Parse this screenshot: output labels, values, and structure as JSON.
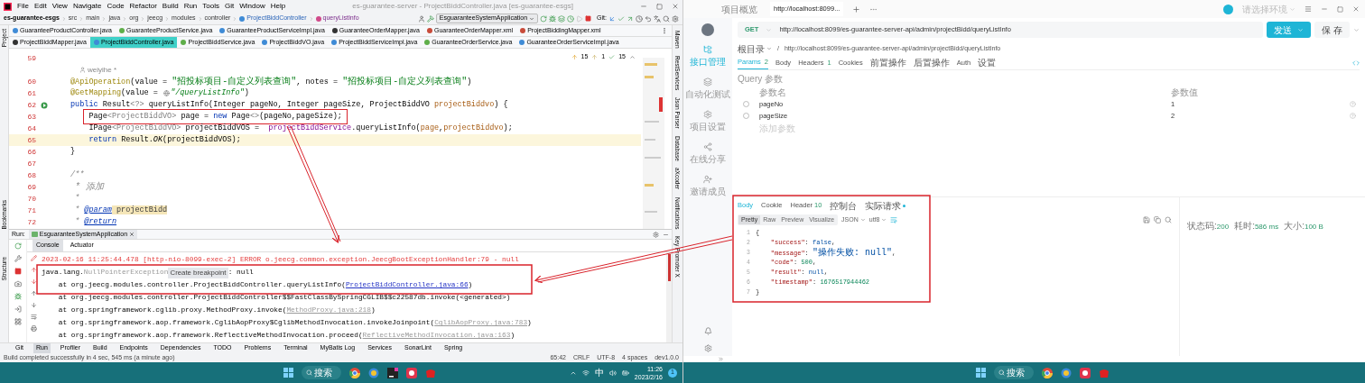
{
  "ide": {
    "menu": [
      "File",
      "Edit",
      "View",
      "Navigate",
      "Code",
      "Refactor",
      "Build",
      "Run",
      "Tools",
      "Git",
      "Window",
      "Help"
    ],
    "title": "es-guarantee-server - ProjectBiddController.java [es-guarantee-esgs]",
    "project": "es-guarantee-esgs",
    "breadcrumbs": [
      {
        "label": "src",
        "kind": "folder"
      },
      {
        "label": "main",
        "kind": "folder"
      },
      {
        "label": "java",
        "kind": "folder"
      },
      {
        "label": "org",
        "kind": "folder"
      },
      {
        "label": "jeecg",
        "kind": "folder"
      },
      {
        "label": "modules",
        "kind": "folder"
      },
      {
        "label": "controller",
        "kind": "folder"
      },
      {
        "label": "ProjectBiddController",
        "kind": "class"
      },
      {
        "label": "queryListInfo",
        "kind": "method"
      }
    ],
    "run_config": "EsguaranteeSystemApplication",
    "git_label": "Git:",
    "tab_rows": [
      [
        {
          "label": "GuaranteeProductController.java",
          "kind": "class",
          "selected": false
        },
        {
          "label": "GuaranteeProductService.java",
          "kind": "interface",
          "selected": false
        },
        {
          "label": "GuaranteeProductServiceImpl.java",
          "kind": "class",
          "selected": false
        },
        {
          "label": "GuaranteeOrderMapper.java",
          "kind": "mapper",
          "selected": false
        },
        {
          "label": "GuaranteeOrderMapper.xml",
          "kind": "xml",
          "selected": false
        },
        {
          "label": "ProjectBiddingMapper.xml",
          "kind": "xml",
          "selected": false
        }
      ],
      [
        {
          "label": "ProjectBiddMapper.java",
          "kind": "mapper",
          "selected": false
        },
        {
          "label": "ProjectBiddController.java",
          "kind": "class",
          "selected": true
        },
        {
          "label": "ProjectBiddService.java",
          "kind": "interface",
          "selected": false
        },
        {
          "label": "ProjectBiddVO.java",
          "kind": "class",
          "selected": false
        },
        {
          "label": "ProjectBiddServiceImpl.java",
          "kind": "class",
          "selected": false
        },
        {
          "label": "GuaranteeOrderService.java",
          "kind": "interface",
          "selected": false
        },
        {
          "label": "GuaranteeOrderServiceImpl.java",
          "kind": "class",
          "selected": false
        }
      ]
    ],
    "inspections": {
      "warnings": "15",
      "weak_warnings": "1",
      "ok": "15"
    },
    "code": [
      {
        "kind": "line",
        "number": "59",
        "current": false,
        "runnable": false,
        "boxed": false
      },
      {
        "kind": "author",
        "text": "weiyihe *"
      },
      {
        "kind": "line",
        "number": "60",
        "current": false,
        "runnable": false,
        "boxed": false,
        "segments": [
          {
            "text": "@ApiOperation",
            "kind": "ann"
          },
          {
            "text": "(value = ",
            "kind": "plain"
          },
          {
            "text": "\"招投标项目-自定义列表查询\"",
            "kind": "str"
          },
          {
            "text": ", notes = ",
            "kind": "plain"
          },
          {
            "text": "\"招投标项目-自定义列表查询\"",
            "kind": "str"
          },
          {
            "text": ")",
            "kind": "plain"
          }
        ]
      },
      {
        "kind": "line",
        "number": "61",
        "current": false,
        "runnable": false,
        "boxed": false,
        "segments": [
          {
            "text": "@GetMapping",
            "kind": "ann"
          },
          {
            "text": "(value = ",
            "kind": "plain"
          },
          {
            "text": "\"/queryListInfo\"",
            "kind": "route"
          },
          {
            "text": ")",
            "kind": "plain"
          }
        ]
      },
      {
        "kind": "line",
        "number": "62",
        "current": false,
        "runnable": true,
        "boxed": false,
        "segments": [
          {
            "text": "public ",
            "kind": "kw"
          },
          {
            "text": "Result",
            "kind": "plain"
          },
          {
            "text": "<?>",
            "kind": "gen"
          },
          {
            "text": " queryListInfo(Integer pageNo, Integer pageSize, ProjectBiddVO ",
            "kind": "plain"
          },
          {
            "text": "projectBiddvo",
            "kind": "param"
          },
          {
            "text": ") {",
            "kind": "plain"
          }
        ]
      },
      {
        "kind": "line",
        "number": "63",
        "current": false,
        "runnable": false,
        "boxed": true,
        "segments": [
          {
            "text": "    Page",
            "kind": "plain"
          },
          {
            "text": "<ProjectBiddVO>",
            "kind": "gen"
          },
          {
            "text": " page = ",
            "kind": "plain"
          },
          {
            "text": "new ",
            "kind": "kw"
          },
          {
            "text": "Page",
            "kind": "plain"
          },
          {
            "text": "<>",
            "kind": "gen"
          },
          {
            "text": "(pageNo,pageSize);",
            "kind": "plain"
          }
        ]
      },
      {
        "kind": "line",
        "number": "64",
        "current": false,
        "runnable": false,
        "boxed": false,
        "segments": [
          {
            "text": "    IPage",
            "kind": "plain"
          },
          {
            "text": "<ProjectBiddVO>",
            "kind": "gen"
          },
          {
            "text": " projectBiddVOS =  ",
            "kind": "plain"
          },
          {
            "text": "projectBiddService",
            "kind": "field"
          },
          {
            "text": ".queryListInfo(",
            "kind": "plain"
          },
          {
            "text": "page",
            "kind": "param"
          },
          {
            "text": ",",
            "kind": "plain"
          },
          {
            "text": "projectBiddvo",
            "kind": "param"
          },
          {
            "text": ");",
            "kind": "plain"
          }
        ]
      },
      {
        "kind": "line",
        "number": "65",
        "current": true,
        "runnable": false,
        "boxed": false,
        "segments": [
          {
            "text": "    return ",
            "kind": "kw"
          },
          {
            "text": "Result.",
            "kind": "plain"
          },
          {
            "text": "OK",
            "kind": "static"
          },
          {
            "text": "(projectBiddVOS);",
            "kind": "plain"
          }
        ]
      },
      {
        "kind": "line",
        "number": "66",
        "current": false,
        "runnable": false,
        "boxed": false,
        "segments": [
          {
            "text": "}",
            "kind": "plain"
          }
        ]
      },
      {
        "kind": "line",
        "number": "67",
        "current": false,
        "runnable": false,
        "boxed": false
      },
      {
        "kind": "line",
        "number": "68",
        "current": false,
        "runnable": false,
        "boxed": false,
        "segments": [
          {
            "text": "/**",
            "kind": "comment"
          }
        ]
      },
      {
        "kind": "line",
        "number": "69",
        "current": false,
        "runnable": false,
        "boxed": false,
        "segments": [
          {
            "text": " * 添加",
            "kind": "comment"
          }
        ]
      },
      {
        "kind": "line",
        "number": "70",
        "current": false,
        "runnable": false,
        "boxed": false,
        "segments": [
          {
            "text": " *",
            "kind": "comment"
          }
        ]
      },
      {
        "kind": "line",
        "number": "71",
        "current": false,
        "runnable": false,
        "boxed": false,
        "segments": [
          {
            "text": " * ",
            "kind": "comment"
          },
          {
            "text": "@param",
            "kind": "doctag"
          },
          {
            "text": " projectBidd",
            "kind": "docparam"
          }
        ]
      },
      {
        "kind": "line",
        "number": "72",
        "current": false,
        "runnable": false,
        "boxed": false,
        "segments": [
          {
            "text": " * ",
            "kind": "comment"
          },
          {
            "text": "@return",
            "kind": "doctag"
          }
        ]
      }
    ],
    "run_label": "Run:",
    "run_tab": "EsguaranteeSystemApplication",
    "console_tabs": [
      {
        "label": "Console",
        "selected": true
      },
      {
        "label": "Actuator",
        "selected": false
      }
    ],
    "console": [
      [
        {
          "text": "2023-02-16 11:25:44.478 [http-nio-8099-exec-2] ERROR o.jeecg.common.exception.JeecgBootExceptionHandler:79 - null",
          "kind": "err"
        }
      ],
      [
        {
          "text": "java.lang.",
          "kind": "plain"
        },
        {
          "text": "NullPointerException",
          "kind": "dim"
        },
        {
          "text": " Create breakpoint ",
          "kind": "hint"
        },
        {
          "text": ": null",
          "kind": "plain"
        }
      ],
      [
        {
          "text": "    at org.jeecg.modules.controller.ProjectBiddController.queryListInfo(",
          "kind": "plain"
        },
        {
          "text": "ProjectBiddController.java:66",
          "kind": "link"
        },
        {
          "text": ")",
          "kind": "plain"
        }
      ],
      [
        {
          "text": "    at org.jeecg.modules.controller.ProjectBiddController$$FastClassBySpringCGLIB$$c22587db.invoke(<generated>)",
          "kind": "plain"
        }
      ],
      [
        {
          "text": "    at org.springframework.cglib.proxy.MethodProxy.invoke(",
          "kind": "plain"
        },
        {
          "text": "MethodProxy.java:218",
          "kind": "glink"
        },
        {
          "text": ")",
          "kind": "plain"
        }
      ],
      [
        {
          "text": "    at org.springframework.aop.framework.CglibAopProxy$CglibMethodInvocation.invokeJoinpoint(",
          "kind": "plain"
        },
        {
          "text": "CglibAopProxy.java:783",
          "kind": "glink"
        },
        {
          "text": ")",
          "kind": "plain"
        }
      ],
      [
        {
          "text": "    at org.springframework.aop.framework.ReflectiveMethodInvocation.proceed(",
          "kind": "plain"
        },
        {
          "text": "ReflectiveMethodInvocation.java:163",
          "kind": "glink"
        },
        {
          "text": ")",
          "kind": "plain"
        }
      ]
    ],
    "tool_tabs": [
      {
        "label": "Git",
        "selected": false
      },
      {
        "label": "Run",
        "selected": true
      },
      {
        "label": "Profiler",
        "selected": false
      },
      {
        "label": "Build",
        "selected": false
      },
      {
        "label": "Endpoints",
        "selected": false
      },
      {
        "label": "Dependencies",
        "selected": false
      },
      {
        "label": "TODO",
        "selected": false
      },
      {
        "label": "Problems",
        "selected": false
      },
      {
        "label": "Terminal",
        "selected": false
      },
      {
        "label": "MyBatis Log",
        "selected": false
      },
      {
        "label": "Services",
        "selected": false
      },
      {
        "label": "SonarLint",
        "selected": false
      },
      {
        "label": "Spring",
        "selected": false
      }
    ],
    "status": {
      "message": "Build completed successfully in 4 sec, 545 ms (a minute ago)",
      "position": "65:42",
      "line_ending": "CRLF",
      "encoding": "UTF-8",
      "indent": "4 spaces",
      "branch": "dev1.0.0"
    },
    "left_strip": [
      "Project",
      "Bookmarks",
      "Structure"
    ],
    "right_strip": [
      "Maven",
      "RestServices",
      "Json Parser",
      "Database",
      "aXcoder",
      "Notifications",
      "Key Promoter X"
    ],
    "taskbar": {
      "search": "搜索",
      "ime": "中",
      "time": "11:26",
      "date": "2023/2/16",
      "badge": "1"
    }
  },
  "api": {
    "tabs": [
      {
        "label": "项目概览",
        "selected": false
      },
      {
        "label": "http://localhost:8099...",
        "selected": true
      }
    ],
    "env_placeholder": "请选择环境",
    "sidebar": [
      {
        "label": "接口管理",
        "selected": true
      },
      {
        "label": "自动化测试",
        "selected": false
      },
      {
        "label": "项目设置",
        "selected": false
      },
      {
        "label": "在线分享",
        "selected": false
      },
      {
        "label": "邀请成员",
        "selected": false
      }
    ],
    "method": "GET",
    "url": "http://localhost:8099/es-guarantee-server-api/admin/projectBidd/queryListInfo",
    "send": "发送",
    "save": "保 存",
    "root": "根目录",
    "path_sep": "/",
    "path": "http://localhost:8099/es-guarantee-server-api/admin/projectBidd/queryListInfo",
    "request_tabs": [
      {
        "label": "Params",
        "count": "2",
        "selected": true
      },
      {
        "label": "Body",
        "selected": false
      },
      {
        "label": "Headers",
        "count": "1",
        "selected": false
      },
      {
        "label": "Cookies",
        "selected": false
      },
      {
        "label": "前置操作",
        "selected": false
      },
      {
        "label": "后置操作",
        "selected": false
      },
      {
        "label": "Auth",
        "selected": false
      },
      {
        "label": "设置",
        "selected": false
      }
    ],
    "query_label": "Query 参数",
    "columns": [
      "参数名",
      "参数值"
    ],
    "params": [
      {
        "name": "pageNo",
        "value": "1",
        "checked": false
      },
      {
        "name": "pageSize",
        "value": "2",
        "checked": false
      }
    ],
    "add_placeholder": "添加参数",
    "response_tabs": [
      {
        "label": "Body",
        "selected": true,
        "dot": false
      },
      {
        "label": "Cookie",
        "selected": false,
        "dot": false
      },
      {
        "label": "Header",
        "count": "10",
        "selected": false,
        "dot": false
      },
      {
        "label": "控制台",
        "selected": false,
        "dot": false
      },
      {
        "label": "实际请求",
        "dot": true,
        "selected": false
      }
    ],
    "view_modes": [
      {
        "label": "Pretty",
        "selected": true
      },
      {
        "label": "Raw",
        "selected": false
      },
      {
        "label": "Preview",
        "selected": false
      },
      {
        "label": "Visualize",
        "selected": false
      }
    ],
    "format": "JSON",
    "charset": "utf8",
    "body": [
      {
        "number": "1",
        "segments": [
          {
            "text": "{",
            "kind": "punc"
          }
        ]
      },
      {
        "number": "2",
        "segments": [
          {
            "text": "    \"success\"",
            "kind": "key"
          },
          {
            "text": ": ",
            "kind": "punc"
          },
          {
            "text": "false",
            "kind": "bool"
          },
          {
            "text": ",",
            "kind": "punc"
          }
        ]
      },
      {
        "number": "3",
        "segments": [
          {
            "text": "    \"message\"",
            "kind": "key"
          },
          {
            "text": ": ",
            "kind": "punc"
          },
          {
            "text": "\"操作失败: null\"",
            "kind": "str"
          },
          {
            "text": ",",
            "kind": "punc"
          }
        ]
      },
      {
        "number": "4",
        "segments": [
          {
            "text": "    \"code\"",
            "kind": "key"
          },
          {
            "text": ": ",
            "kind": "punc"
          },
          {
            "text": "500",
            "kind": "num"
          },
          {
            "text": ",",
            "kind": "punc"
          }
        ]
      },
      {
        "number": "5",
        "segments": [
          {
            "text": "    \"result\"",
            "kind": "key"
          },
          {
            "text": ": ",
            "kind": "punc"
          },
          {
            "text": "null",
            "kind": "bool"
          },
          {
            "text": ",",
            "kind": "punc"
          }
        ]
      },
      {
        "number": "6",
        "segments": [
          {
            "text": "    \"timestamp\"",
            "kind": "key"
          },
          {
            "text": ": ",
            "kind": "punc"
          },
          {
            "text": "1676517944462",
            "kind": "num"
          }
        ]
      },
      {
        "number": "7",
        "segments": [
          {
            "text": "}",
            "kind": "punc"
          }
        ]
      }
    ],
    "stats": [
      {
        "label": "状态码:",
        "value": "200"
      },
      {
        "label": "耗时:",
        "value": "586 ms"
      },
      {
        "label": "大小:",
        "value": "100 B"
      }
    ],
    "taskbar": {
      "search": "搜索"
    }
  }
}
